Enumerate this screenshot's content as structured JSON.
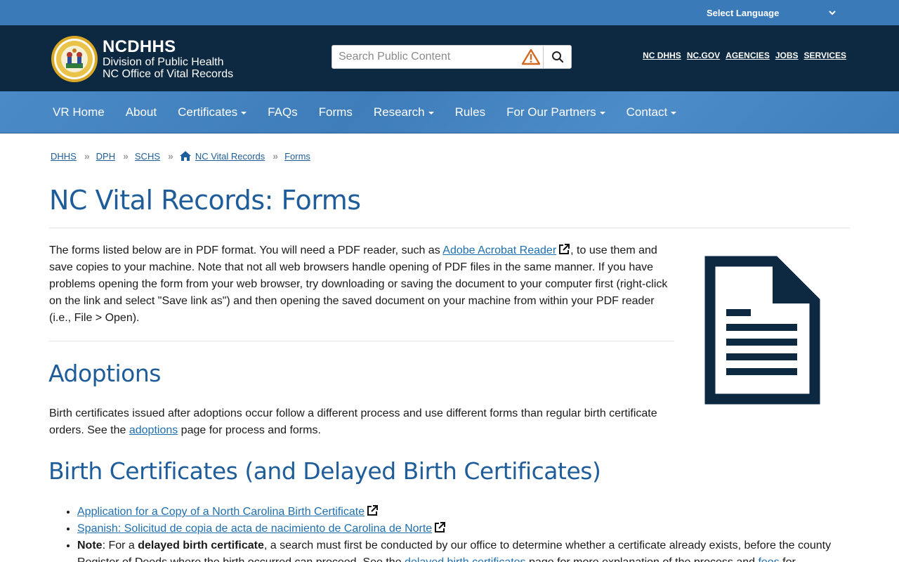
{
  "language": {
    "label": "Select Language"
  },
  "header": {
    "brand_title": "NCDHHS",
    "brand_line2": "Division of Public Health",
    "brand_line3": "NC Office of Vital Records",
    "search_placeholder": "Search Public Content",
    "util_links": [
      "NC DHHS",
      "NC.GOV",
      "AGENCIES",
      "JOBS",
      "SERVICES"
    ]
  },
  "nav": {
    "items": [
      {
        "label": "VR Home",
        "dropdown": false
      },
      {
        "label": "About",
        "dropdown": false
      },
      {
        "label": "Certificates",
        "dropdown": true
      },
      {
        "label": "FAQs",
        "dropdown": false
      },
      {
        "label": "Forms",
        "dropdown": false
      },
      {
        "label": "Research",
        "dropdown": true
      },
      {
        "label": "Rules",
        "dropdown": false
      },
      {
        "label": "For Our Partners",
        "dropdown": true
      },
      {
        "label": "Contact",
        "dropdown": true
      }
    ]
  },
  "breadcrumb": [
    "DHHS",
    "DPH",
    "SCHS",
    "NC Vital Records",
    "Forms"
  ],
  "page": {
    "title": "NC Vital Records: Forms",
    "intro_before": "The forms listed below are in PDF format. You will need a PDF reader, such as ",
    "intro_link": "Adobe Acrobat Reader",
    "intro_after": ", to use them and save copies to your machine. Note that not all web browsers handle opening of PDF files in the same manner. If you have problems opening the form from your web browser, try downloading or saving the document to your computer first (right-click on the link and select \"Save link as\") and then opening the saved document on your machine from within your PDF reader (i.e., File > Open)."
  },
  "adoptions": {
    "heading": "Adoptions",
    "text_before": "Birth certificates issued after adoptions occur follow a different process and use different forms than regular birth certificate orders. See the ",
    "link": "adoptions",
    "text_after": " page for process and forms."
  },
  "birth": {
    "heading": "Birth Certificates (and Delayed Birth Certificates)",
    "link1": "Application for a Copy of a North Carolina Birth Certificate",
    "link2": "Spanish: Solicitud de copia de acta de nacimiento de Carolina de Norte",
    "note_label": "Note",
    "note_a": ": For a ",
    "note_bold": "delayed birth certificate",
    "note_b": ", a search must first be conducted by our office to determine whether a certificate already exists, before the county Register of Deeds where the birth occurred can proceed. See the ",
    "note_link": "delayed birth certificates",
    "note_c": " page for more explanation of the process and ",
    "note_link2": "fees",
    "note_d": " for"
  },
  "colors": {
    "top_bar": "#3a7ab8",
    "header": "#0d2841",
    "nav": "#4585c2",
    "heading": "#1f5d9a",
    "link": "#1f6fb0"
  }
}
